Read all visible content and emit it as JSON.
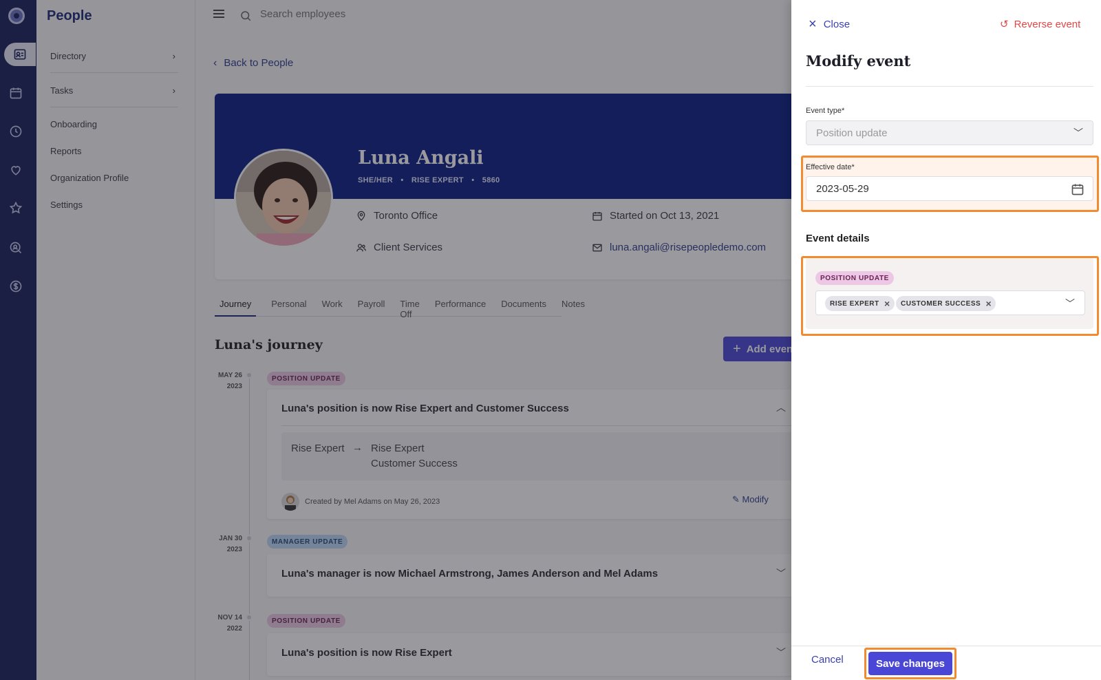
{
  "app": {
    "section_title": "People"
  },
  "subnav": {
    "items": [
      {
        "label": "Directory",
        "has_chevron": true
      },
      {
        "label": "Tasks",
        "has_chevron": true
      },
      {
        "label": "Onboarding"
      },
      {
        "label": "Reports"
      },
      {
        "label": "Organization Profile"
      },
      {
        "label": "Settings"
      }
    ]
  },
  "topbar": {
    "search_placeholder": "Search employees"
  },
  "back_link": "Back to People",
  "profile": {
    "name": "Luna Angali",
    "pronouns": "SHE/HER",
    "title": "RISE EXPERT",
    "employee_id": "5860",
    "sep": "•",
    "location": "Toronto Office",
    "department": "Client Services",
    "start": "Started on Oct 13, 2021",
    "email": "luna.angali@risepeopledemo.com"
  },
  "tabs": [
    "Journey",
    "Personal",
    "Work",
    "Payroll",
    "Time Off",
    "Performance",
    "Documents",
    "Notes"
  ],
  "journey": {
    "title": "Luna's journey",
    "add_button": "Add event",
    "events": [
      {
        "date_line1": "MAY 26",
        "date_line2": "2023",
        "badge": "POSITION UPDATE",
        "title": "Luna's position is now Rise Expert and Customer Success",
        "from": "Rise Expert",
        "to_line1": "Rise Expert",
        "to_line2": "Customer Success",
        "created": "Created by Mel Adams on May 26, 2023",
        "modify": "Modify"
      },
      {
        "date_line1": "JAN 30",
        "date_line2": "2023",
        "badge": "MANAGER UPDATE",
        "title": "Luna's manager is now Michael Armstrong, James Anderson and Mel Adams"
      },
      {
        "date_line1": "NOV 14",
        "date_line2": "2022",
        "badge": "POSITION UPDATE",
        "title": "Luna's position is now Rise Expert"
      }
    ]
  },
  "drawer": {
    "close": "Close",
    "reverse": "Reverse event",
    "title": "Modify event",
    "event_type_label": "Event type",
    "event_type_value": "Position update",
    "effective_date_label": "Effective date",
    "effective_date_value": "2023-05-29",
    "required_mark": "*",
    "details_title": "Event details",
    "details_badge": "POSITION UPDATE",
    "chips": [
      "RISE EXPERT",
      "CUSTOMER SUCCESS"
    ],
    "cancel": "Cancel",
    "save": "Save changes"
  },
  "colors": {
    "rail": "#17205a",
    "banner": "#0a1e84",
    "primary": "#4b47d6",
    "highlight": "#f28a2f",
    "danger": "#e04848"
  }
}
